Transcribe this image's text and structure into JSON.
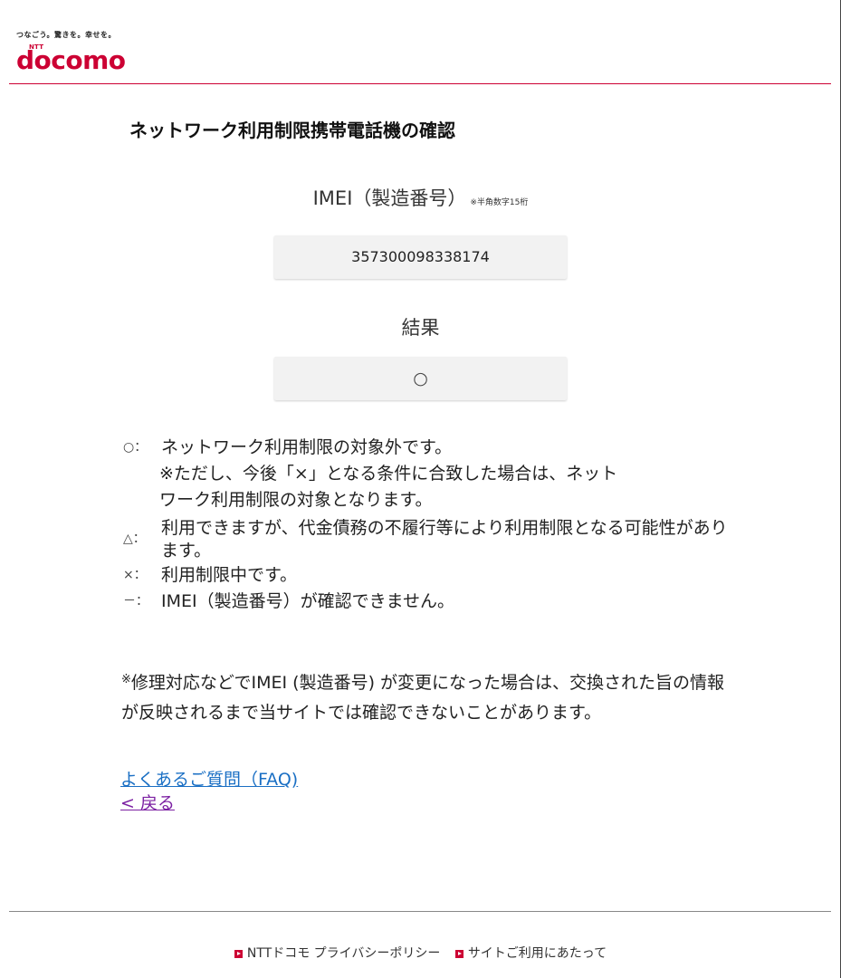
{
  "header": {
    "tagline": "つなごう。驚きを。幸せを。",
    "logo_ntt": "NTT",
    "logo_text": "docomo",
    "brand_color": "#cc0033"
  },
  "main": {
    "title": "ネットワーク利用制限携帯電話機の確認",
    "imei_label": "IMEI（製造番号）",
    "imei_note": "※半角数字15桁",
    "imei_value": "357300098338174",
    "result_label": "結果",
    "result_value": "○"
  },
  "legend": {
    "ok_symbol": "○：",
    "ok_text": "ネットワーク利用制限の対象外です。",
    "ok_note_line1": "※ただし、今後「×」となる条件に合致した場合は、ネット",
    "ok_note_line2": "ワーク利用制限の対象となります。",
    "caution_symbol": "△：",
    "caution_text": "利用できますが、代金債務の不履行等により利用制限となる可能性があります。",
    "ng_symbol": "×：",
    "ng_text": "利用制限中です。",
    "unknown_symbol": "－：",
    "unknown_text": "IMEI（製造番号）が確認できません。"
  },
  "note": {
    "mark": "※",
    "text": "修理対応などでIMEI (製造番号) が変更になった場合は、交換された旨の情報が反映されるまで当サイトでは確認できないことがあります。"
  },
  "links": {
    "faq": "よくあるご質問（FAQ)",
    "back": "< 戻る"
  },
  "footer": {
    "privacy": "NTTドコモ プライバシーポリシー",
    "terms": "サイトご利用にあたって"
  },
  "colors": {
    "accent": "#cc0033",
    "link": "#1a6fc4",
    "visited_link": "#7b1fa2",
    "box_bg": "#f2f2f2"
  }
}
